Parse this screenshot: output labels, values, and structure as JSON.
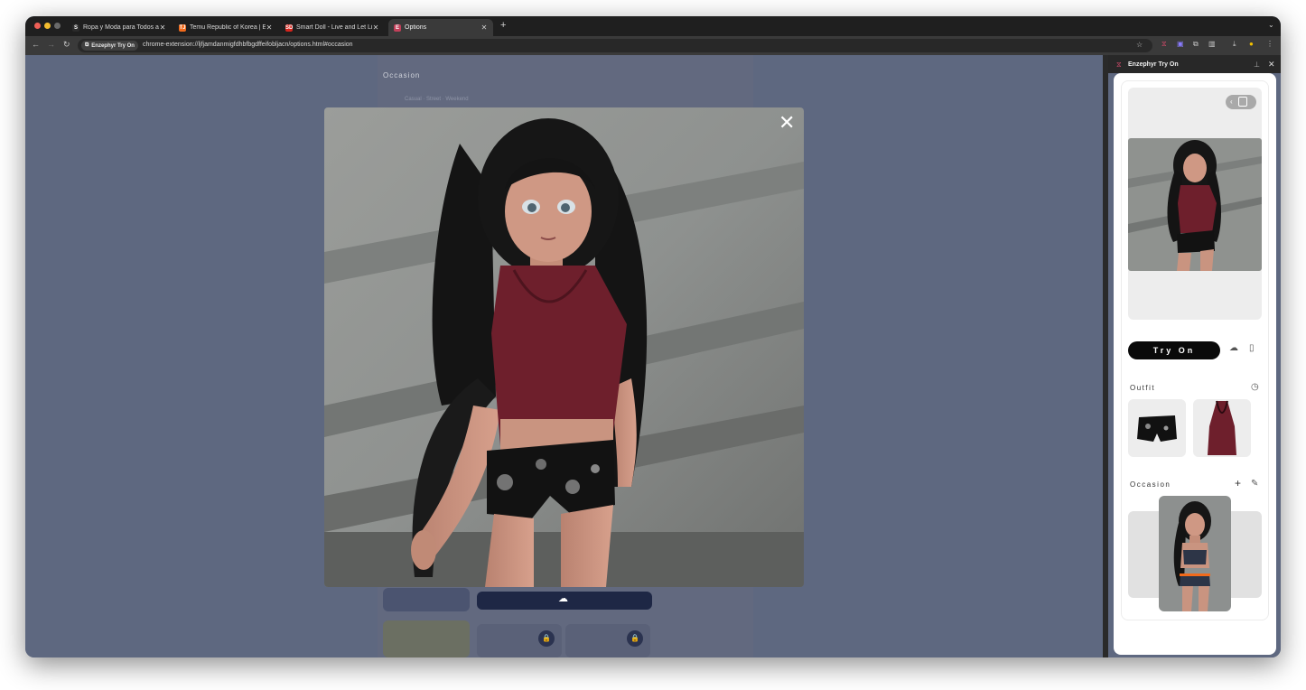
{
  "browser": {
    "tabs": [
      {
        "title": "Ropa y Moda para Todos al Mejor Precio",
        "favicon": "S",
        "favicon_color": "#2b2b2b"
      },
      {
        "title": "Temu Republic of Korea | Explore",
        "favicon": "TJ",
        "favicon_color": "#f26a1b"
      },
      {
        "title": "Smart Doll - Live and Let Live",
        "favicon": "SD",
        "favicon_color": "#d6241c"
      },
      {
        "title": "Options",
        "favicon": "E",
        "favicon_color": "#c2405a"
      }
    ],
    "new_tab": "+",
    "chip_label": "Enzephyr Try On",
    "url": "chrome-extension://ljfjamdanmigfdhbfbgdffeifobljacn/options.html#occasion"
  },
  "background_page": {
    "section_title": "Occasion",
    "option_line": "Casual · Street · Weekend"
  },
  "modal": {
    "close_label": "✕"
  },
  "sidepanel": {
    "title": "Enzephyr Try On",
    "try_on_label": "Try On",
    "outfit_label": "Outfit",
    "occasion_label": "Occasion",
    "plus": "+"
  },
  "colors": {
    "accent_dark": "#0a0a0a",
    "page_overlay": "#5e6880",
    "top_color": "#6e1f2c",
    "shorts_color": "#111111"
  }
}
